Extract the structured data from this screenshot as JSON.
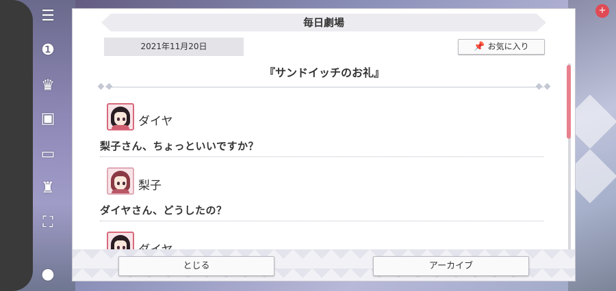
{
  "header": {
    "title": "毎日劇場"
  },
  "meta": {
    "date": "2021年11月20日",
    "favorite_label": "お気に入り"
  },
  "story": {
    "title": "『サンドイッチのお礼』",
    "entries": [
      {
        "speaker": "ダイヤ",
        "text": "梨子さん、ちょっといいですか？"
      },
      {
        "speaker": "梨子",
        "text": "ダイヤさん、どうしたの？"
      },
      {
        "speaker": "ダイヤ",
        "text": ""
      }
    ]
  },
  "footer": {
    "close_label": "とじる",
    "archive_label": "アーカイブ"
  },
  "colors": {
    "accent": "#e8808e",
    "avatar_border": "#d8687a",
    "dia_hair": "#2a1e24",
    "riko_hair": "#8a3a44"
  },
  "background": {
    "badge": "+"
  }
}
